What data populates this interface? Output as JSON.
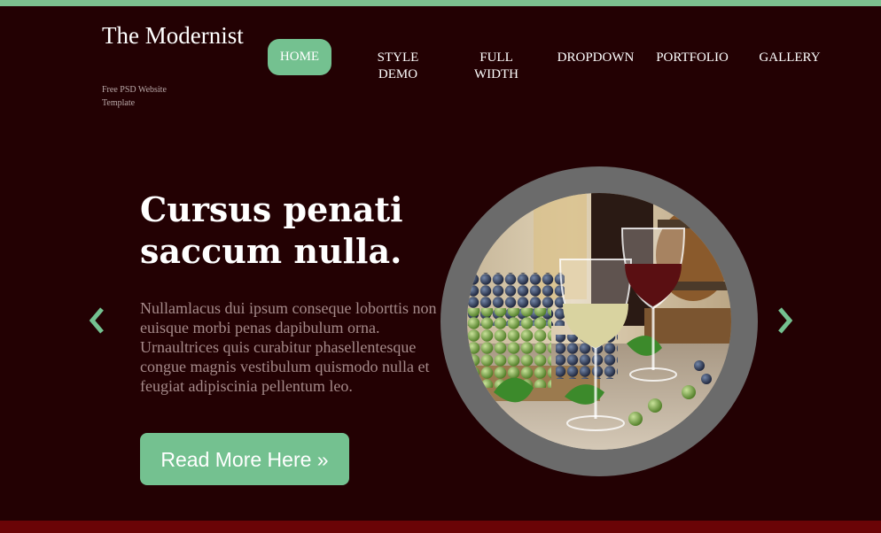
{
  "brand": {
    "title": "The Modernist",
    "tagline": "Free PSD Website Template"
  },
  "nav": {
    "items": [
      "HOME",
      "STYLE DEMO",
      "FULL WIDTH",
      "DROPDOWN",
      "PORTFOLIO",
      "GALLERY"
    ],
    "active": "HOME"
  },
  "slide": {
    "headline": "Cursus penati saccum nulla.",
    "body": "Nullamlacus dui ipsum conseque loborttis non euisque morbi penas dapibulum orna. Urnaultrices quis curabitur phasellentesque congue magnis vestibulum quismodo nulla et feugiat adipiscinia pellentum leo.",
    "button": "Read More Here »",
    "image_icon": "wine-glasses-grapes-photo"
  },
  "controls": {
    "prev_icon": "chevron-left-icon",
    "next_icon": "chevron-right-icon"
  },
  "colors": {
    "background": "#230103",
    "accent": "#74c190",
    "footer_bar": "#6a0406",
    "ring": "#6b6b6b"
  }
}
